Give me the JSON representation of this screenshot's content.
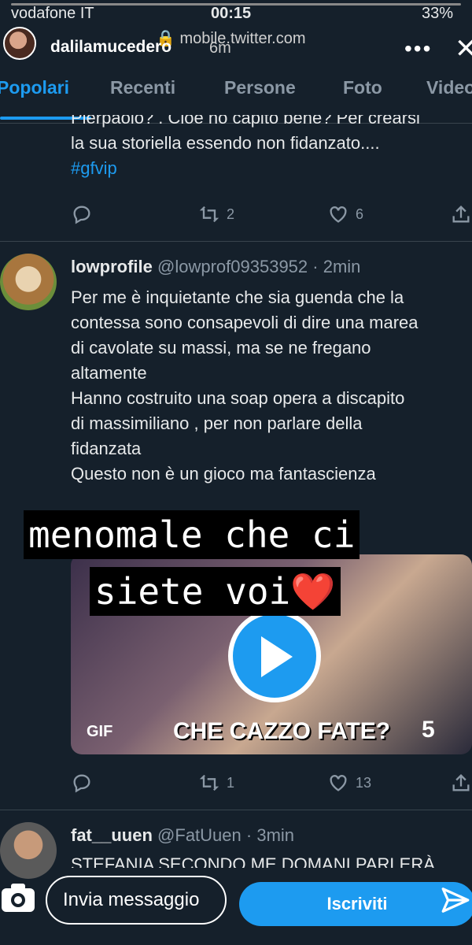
{
  "status_bar": {
    "carrier": "vodafone IT",
    "time": "00:15",
    "battery": "33%"
  },
  "story": {
    "username": "dalilamucedero",
    "time_ago": "6m",
    "url": "mobile.twitter.com"
  },
  "tabs": [
    {
      "label": "Popolari",
      "active": true
    },
    {
      "label": "Recenti"
    },
    {
      "label": "Persone"
    },
    {
      "label": "Foto"
    },
    {
      "label": "Video"
    }
  ],
  "tweet1": {
    "text_lines": [
      "Pierpaolo? . Cioè ho capito bene? Per crearsi",
      "la sua storiella essendo non fidanzato...."
    ],
    "hashtag": "#gfvip",
    "retweets": "2",
    "likes": "6"
  },
  "tweet2": {
    "name": "lowprofile",
    "handle": "@lowprof09353952",
    "time": "· 2min",
    "text_lines": [
      "Per me è inquietante che sia guenda che la",
      "contessa sono consapevoli di dire una marea",
      "di cavolate su massi, ma se ne fregano",
      "altamente",
      "Hanno costruito una soap opera  a discapito",
      "di massimiliano , per non parlare della",
      "fidanzata",
      "Questo non è un gioco ma fantascienza"
    ],
    "media_badge": "GIF",
    "media_caption": "CHE CAZZO FATE?",
    "media_logo": "5",
    "retweets": "1",
    "likes": "13"
  },
  "story_caption": {
    "line1": "menomale che ci",
    "line2": "siete voi",
    "emoji": "❤️"
  },
  "tweet3": {
    "name": "fat__uuen",
    "handle": "@FatUuen",
    "time": "· 3min",
    "text_line": "STEFANIA SECONDO ME DOMANI PARLERÀ"
  },
  "bottom_bar": {
    "message_placeholder": "Invia messaggio",
    "subscribe_label": "Iscriviti"
  },
  "icons": [
    "camera-icon",
    "send-icon",
    "reply-icon",
    "retweet-icon",
    "like-icon",
    "share-icon",
    "play-icon",
    "close-icon",
    "more-icon",
    "lock-icon"
  ]
}
